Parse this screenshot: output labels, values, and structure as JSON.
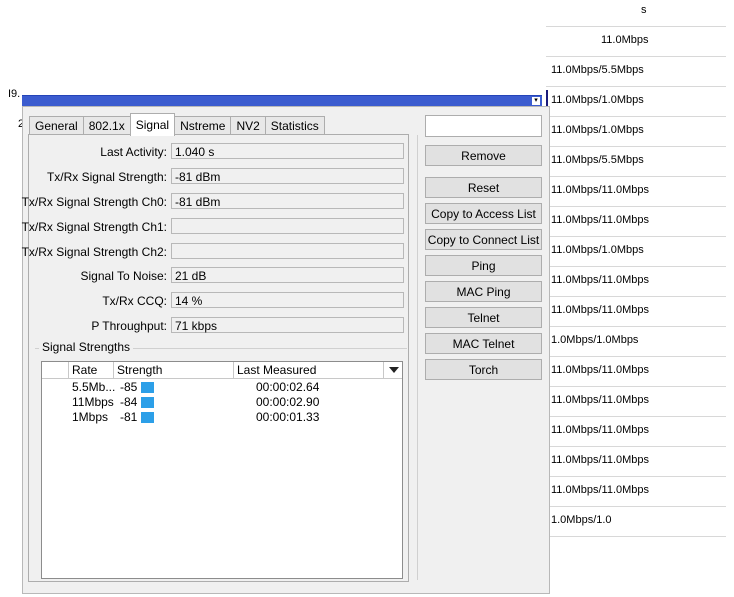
{
  "background": {
    "left_label_top": "I9.",
    "left_label_bottom": "2",
    "rates": [
      "s",
      "11.0Mbps",
      "11.0Mbps/5.5Mbps",
      "11.0Mbps/1.0Mbps",
      "11.0Mbps/1.0Mbps",
      "11.0Mbps/5.5Mbps",
      "11.0Mbps/11.0Mbps",
      "11.0Mbps/11.0Mbps",
      "11.0Mbps/1.0Mbps",
      "11.0Mbps/11.0Mbps",
      "11.0Mbps/11.0Mbps",
      "1.0Mbps/1.0Mbps",
      "11.0Mbps/11.0Mbps",
      "11.0Mbps/11.0Mbps",
      "11.0Mbps/11.0Mbps",
      "11.0Mbps/11.0Mbps",
      "11.0Mbps/11.0Mbps",
      "1.0Mbps/1.0"
    ]
  },
  "tabs": [
    "General",
    "802.1x",
    "Signal",
    "Nstreme",
    "NV2",
    "Statistics"
  ],
  "active_tab": "Signal",
  "fields": [
    {
      "label": "Last Activity:",
      "value": "1.040 s"
    },
    {
      "label": "Tx/Rx Signal Strength:",
      "value": "-81 dBm"
    },
    {
      "label": "Tx/Rx Signal Strength Ch0:",
      "value": "-81 dBm"
    },
    {
      "label": "Tx/Rx Signal Strength Ch1:",
      "value": ""
    },
    {
      "label": "Tx/Rx Signal Strength Ch2:",
      "value": ""
    },
    {
      "label": "Signal To Noise:",
      "value": "21 dB"
    },
    {
      "label": "Tx/Rx CCQ:",
      "value": "14 %"
    },
    {
      "label": "P Throughput:",
      "value": "71 kbps"
    }
  ],
  "signal_strengths": {
    "title": "Signal Strengths",
    "columns": [
      "Rate",
      "Strength",
      "Last Measured"
    ],
    "rows": [
      {
        "rate": "5.5Mb...",
        "strength": "-85",
        "last": "00:00:02.64"
      },
      {
        "rate": "11Mbps",
        "strength": "-84",
        "last": "00:00:02.90"
      },
      {
        "rate": "1Mbps",
        "strength": "-81",
        "last": "00:00:01.33"
      }
    ],
    "bar_color": "#2c9fe8"
  },
  "buttons": {
    "top_partial": "",
    "remove": "Remove",
    "reset": "Reset",
    "copy_access": "Copy to Access List",
    "copy_connect": "Copy to Connect List",
    "ping": "Ping",
    "mac_ping": "MAC Ping",
    "telnet": "Telnet",
    "mac_telnet": "MAC Telnet",
    "torch": "Torch"
  },
  "colors": {
    "titlebar": "#3b5ccf",
    "accent": "#2c9fe8"
  }
}
